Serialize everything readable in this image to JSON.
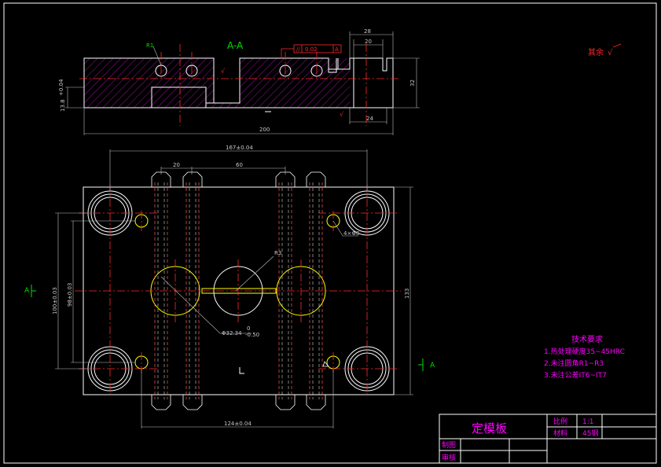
{
  "section": {
    "label": "A-A",
    "flatness": "0.02",
    "flatness_datum": "A",
    "dims": {
      "length": "200",
      "height": "32",
      "width_top_outer": "28",
      "width_top_inner": "20",
      "width_bottom": "24",
      "step": "13.8",
      "step_tol": "+0.04",
      "radius": "R1"
    }
  },
  "plan": {
    "dims": {
      "top_span": "167±0.04",
      "pitch_a": "20",
      "pitch_b": "60",
      "bottom_span": "124±0.04",
      "left_outer": "100±0.03",
      "left_inner": "98±0.03",
      "height_right": "133",
      "hole_dia": "Φ32.34",
      "hole_tol_upper": "0",
      "hole_tol_lower": "-0.50",
      "radius": "R3",
      "small_hole": "4×Φ8"
    },
    "section_marker": "A"
  },
  "roughness_note": "其余",
  "tech_req": {
    "title": "技术要求",
    "items": [
      "1.热处理硬度35~45HRC",
      "2.未注圆角R1~R3",
      "3.未注公差IT6~IT7"
    ]
  },
  "title_block": {
    "part_name": "定模板",
    "scale_label": "比例",
    "scale_value": "1:1",
    "material_label": "材料",
    "material_value": "45钢",
    "drawn_label": "制图",
    "checked_label": "审核"
  },
  "colors": {
    "background": "#000000",
    "outline": "#ffffff",
    "centerline": "#ff2a2a",
    "hatch": "#d020d0",
    "hole": "#ffff00",
    "title_text": "#ff00ff",
    "label_green": "#00e000"
  }
}
